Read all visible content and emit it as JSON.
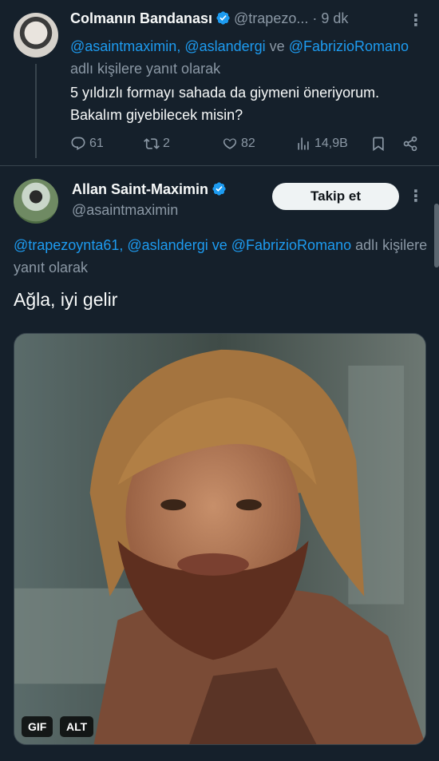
{
  "tweet1": {
    "author_name": "Colmanın Bandanası",
    "handle": "@trapezo...",
    "separator": "·",
    "time": "9 dk",
    "reply_mentions_1": "@asaintmaximin, @aslandergi",
    "reply_conj": "ve",
    "reply_mentions_2": "@FabrizioRomano",
    "reply_suffix": "adlı kişilere yanıt olarak",
    "text": "5 yıldızlı formayı sahada da giymeni öneriyorum. Bakalım giyebilecek misin?",
    "replies": "61",
    "retweets": "2",
    "likes": "82",
    "views": "14,9B"
  },
  "tweet2": {
    "author_name": "Allan Saint-Maximin",
    "handle": "@asaintmaximin",
    "follow_label": "Takip et",
    "reply_mention_a": "@trapezoynta61,",
    "reply_mention_b": "@aslandergi",
    "reply_conj": "ve",
    "reply_mention_c": "@FabrizioRomano",
    "reply_suffix": "adlı kişilere yanıt olarak",
    "text": "Ağla, iyi gelir",
    "gif_badge": "GIF",
    "alt_badge": "ALT"
  },
  "colors": {
    "background": "#15202b",
    "accent": "#1d9bf0",
    "muted": "#8b98a5",
    "divider": "#38444d"
  },
  "icons": [
    "verified-badge-icon",
    "more-options-icon",
    "reply-icon",
    "retweet-icon",
    "like-icon",
    "views-icon",
    "bookmark-icon",
    "share-icon"
  ]
}
